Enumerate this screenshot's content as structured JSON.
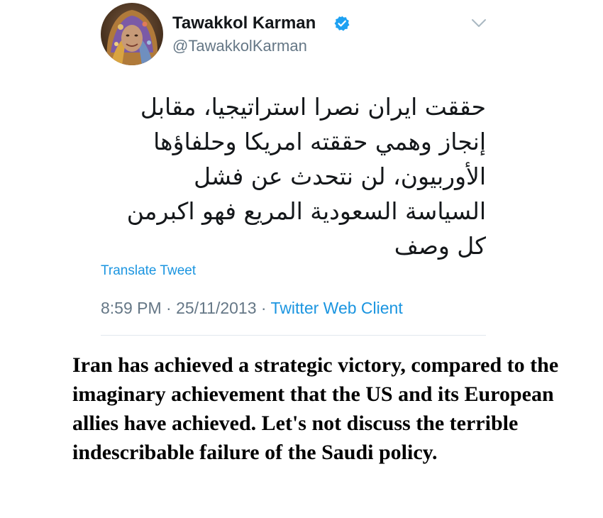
{
  "tweet": {
    "display_name": "Tawakkol Karman",
    "handle": "@TawakkolKarman",
    "text": "حققت ايران نصرا استراتيجيا، مقابل إنجاز وهمي حققته امريكا وحلفاؤها الأوربيون، لن نتحدث عن فشل السياسة السعودية المريع فهو اكبرمن كل وصف",
    "translate_label": "Translate Tweet",
    "time": "8:59 PM",
    "date": "25/11/2013",
    "source": "Twitter Web Client",
    "separator": " · "
  },
  "caption": {
    "text": "Iran has achieved a strategic victory, compared to the imaginary achievement that the US and its European allies have achieved. Let's not discuss the terrible indescribable failure of the Saudi policy."
  },
  "icons": {
    "verified": "verified-badge-icon",
    "menu": "chevron-down-icon"
  },
  "colors": {
    "link_blue": "#1b95e0",
    "muted_gray": "#657786",
    "text_dark": "#14171a"
  }
}
